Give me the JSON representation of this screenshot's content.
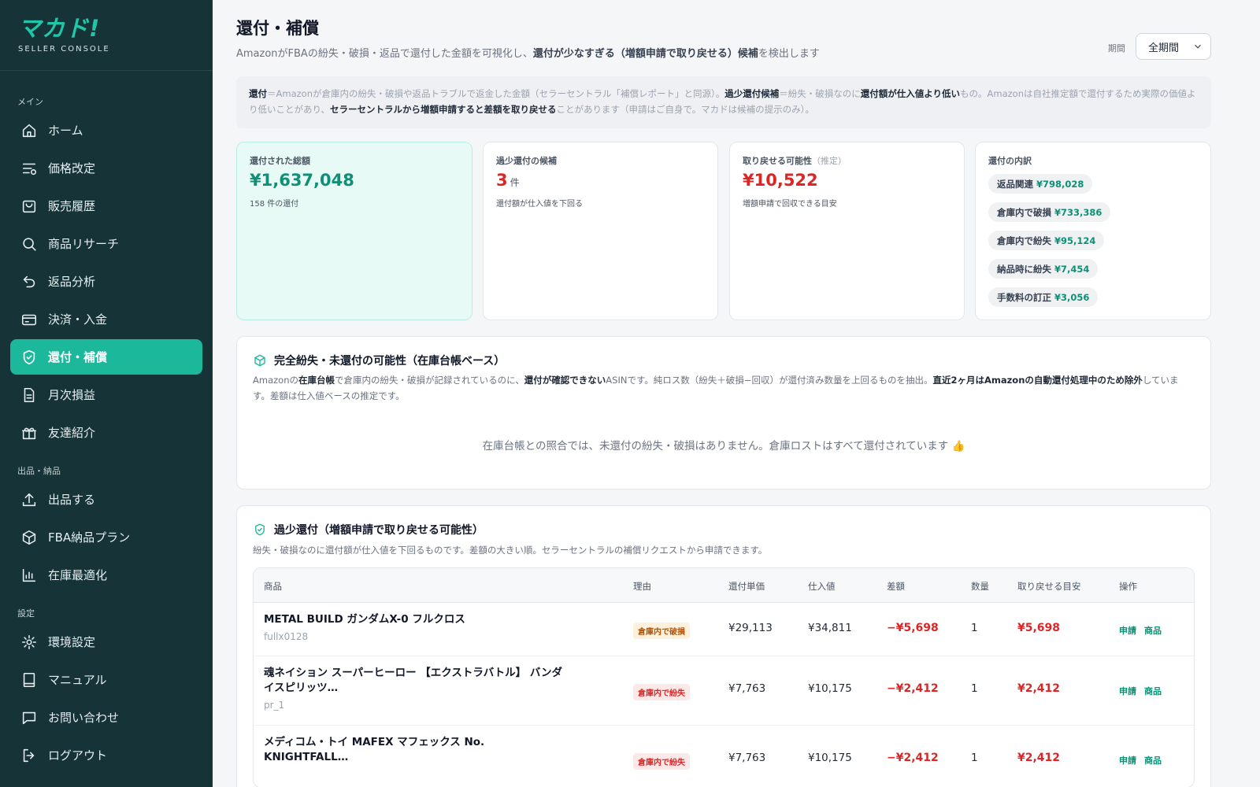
{
  "brand": {
    "logo": "マカド!",
    "sub": "SELLER CONSOLE"
  },
  "sidebar": {
    "sections": [
      {
        "label": "メイン"
      },
      {
        "label": "出品・納品"
      },
      {
        "label": "設定"
      }
    ],
    "items": [
      {
        "label": "ホーム",
        "icon": "home-icon"
      },
      {
        "label": "価格改定",
        "icon": "price-list-icon"
      },
      {
        "label": "販売履歴",
        "icon": "shopping-bag-icon"
      },
      {
        "label": "商品リサーチ",
        "icon": "search-icon"
      },
      {
        "label": "返品分析",
        "icon": "return-arrow-icon"
      },
      {
        "label": "決済・入金",
        "icon": "credit-card-icon"
      },
      {
        "label": "還付・補償",
        "icon": "shield-check-icon",
        "active": true
      },
      {
        "label": "月次損益",
        "icon": "document-icon"
      },
      {
        "label": "友達紹介",
        "icon": "gift-icon"
      },
      {
        "label": "出品する",
        "icon": "upload-icon"
      },
      {
        "label": "FBA納品プラン",
        "icon": "box-icon"
      },
      {
        "label": "在庫最適化",
        "icon": "bar-chart-icon"
      },
      {
        "label": "環境設定",
        "icon": "gear-icon"
      },
      {
        "label": "マニュアル",
        "icon": "book-icon"
      },
      {
        "label": "お問い合わせ",
        "icon": "chat-icon"
      },
      {
        "label": "ログアウト",
        "icon": "logout-icon"
      }
    ]
  },
  "header": {
    "title": "還付・補償",
    "subtitle_a": "AmazonがFBAの紛失・破損・返品で還付した金額を可視化し、",
    "subtitle_b": "還付が少なすぎる（増額申請で取り戻せる）候補",
    "subtitle_c": "を検出します",
    "period_label": "期間",
    "period_value": "全期間"
  },
  "notice": {
    "t1": "還付",
    "t2": "＝Amazonが倉庫内の紛失・破損や返品トラブルで返金した金額（セラーセントラル「補償レポート」と同源）。",
    "t3": "過少還付候補",
    "t4": "＝紛失・破損なのに",
    "t5": "還付額が仕入値より低い",
    "t6": "もの。Amazonは自社推定額で還付するため実際の価値より低いことがあり、",
    "t7": "セラーセントラルから増額申請すると差額を取り戻せる",
    "t8": "ことがあります（申請はご自身で。マカドは候補の提示のみ）。"
  },
  "stats": {
    "total": {
      "label": "還付された総額",
      "value": "¥1,637,048",
      "sub": "158 件の還付"
    },
    "under": {
      "label": "過少還付の候補",
      "value": "3",
      "unit": "件",
      "sub": "還付額が仕入値を下回る"
    },
    "recover": {
      "label": "取り戻せる可能性",
      "label_note": "（推定）",
      "value": "¥10,522",
      "sub": "増額申請で回収できる目安"
    },
    "breakdown": {
      "label": "還付の内訳",
      "items": [
        {
          "name": "返品関連",
          "amount": "¥798,028"
        },
        {
          "name": "倉庫内で破損",
          "amount": "¥733,386"
        },
        {
          "name": "倉庫内で紛失",
          "amount": "¥95,124"
        },
        {
          "name": "納品時に紛失",
          "amount": "¥7,454"
        },
        {
          "name": "手数料の訂正",
          "amount": "¥3,056"
        }
      ]
    }
  },
  "ledger": {
    "title": "完全紛失・未還付の可能性（在庫台帳ベース）",
    "d1": "Amazonの",
    "d2": "在庫台帳",
    "d3": "で倉庫内の紛失・破損が記録されているのに、",
    "d4": "還付が確認できない",
    "d5": "ASINです。純ロス数（紛失＋破損−回収）が還付済み数量を上回るものを抽出。",
    "d6": "直近2ヶ月はAmazonの自動還付処理中のため除外",
    "d7": "しています。差額は仕入値ベースの推定です。",
    "empty": "在庫台帳との照合では、未還付の紛失・破損はありません。倉庫ロストはすべて還付されています 👍"
  },
  "under_section": {
    "title": "過少還付（増額申請で取り戻せる可能性）",
    "desc": "紛失・破損なのに還付額が仕入値を下回るものです。差額の大きい順。セラーセントラルの補償リクエストから申請できます。",
    "columns": [
      "商品",
      "理由",
      "還付単価",
      "仕入値",
      "差額",
      "数量",
      "取り戻せる目安",
      "操作"
    ],
    "rows": [
      {
        "name": "METAL BUILD ガンダムX-0 フルクロス",
        "sku": "fullx0128",
        "reason": "倉庫内で破損",
        "reason_color": "amber",
        "unit": "¥29,113",
        "cost": "¥34,811",
        "diff": "−¥5,698",
        "qty": "1",
        "recover": "¥5,698",
        "act1": "申請",
        "act2": "商品"
      },
      {
        "name": "魂ネイション スーパーヒーロー 【エクストラバトル】 バンダイスピリッツ…",
        "sku": "pr_1",
        "reason": "倉庫内で紛失",
        "reason_color": "red",
        "unit": "¥7,763",
        "cost": "¥10,175",
        "diff": "−¥2,412",
        "qty": "1",
        "recover": "¥2,412",
        "act1": "申請",
        "act2": "商品"
      },
      {
        "name": "メディコム・トイ MAFEX マフェックス No. KNIGHTFALL…",
        "sku": "",
        "reason": "倉庫内で紛失",
        "reason_color": "red",
        "unit": "¥7,763",
        "cost": "¥10,175",
        "diff": "−¥2,412",
        "qty": "1",
        "recover": "¥2,412",
        "act1": "申請",
        "act2": "商品"
      }
    ]
  },
  "colors": {
    "accent": "#1bb89c",
    "sidebar": "#163338",
    "negative": "#dc2626",
    "positive": "#0f8f75"
  }
}
